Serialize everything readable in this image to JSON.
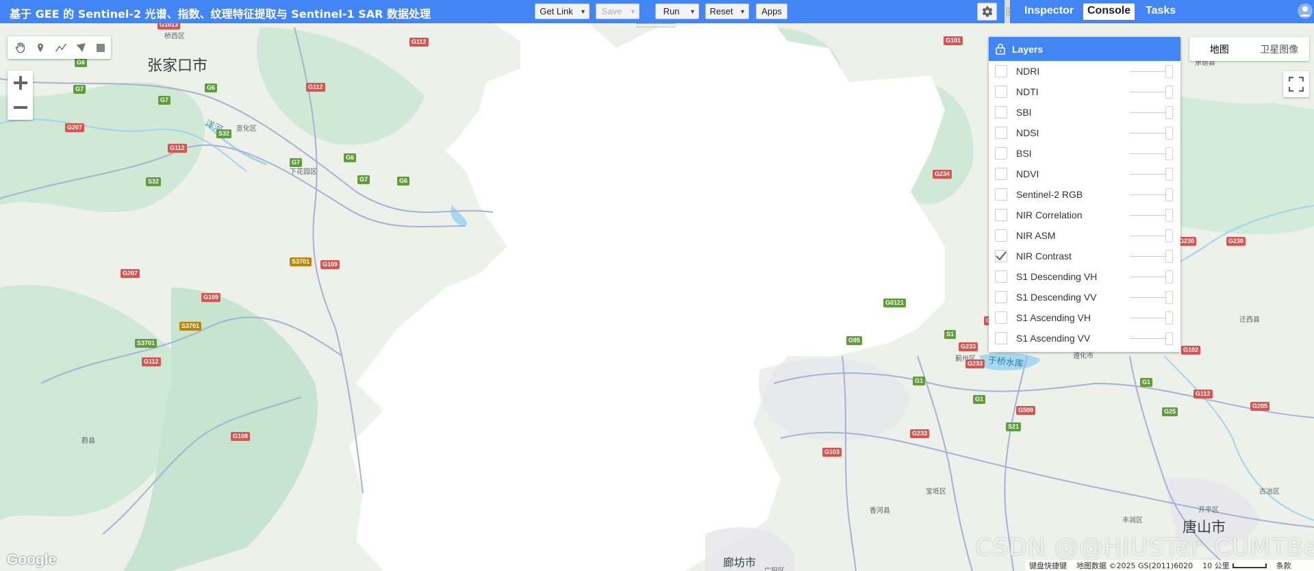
{
  "header": {
    "title": "基于 GEE 的 Sentinel-2 光谱、指数、纹理特征提取与 Sentinel-1 SAR 数据处理",
    "get_link": "Get Link",
    "save": "Save",
    "run": "Run",
    "reset": "Reset",
    "apps": "Apps"
  },
  "panel_tabs": [
    "Inspector",
    "Console",
    "Tasks"
  ],
  "layers": {
    "title": "Layers",
    "items": [
      {
        "name": "NDRI",
        "checked": false
      },
      {
        "name": "NDTI",
        "checked": false
      },
      {
        "name": "SBI",
        "checked": false
      },
      {
        "name": "NDSI",
        "checked": false
      },
      {
        "name": "BSI",
        "checked": false
      },
      {
        "name": "NDVI",
        "checked": false
      },
      {
        "name": "Sentinel-2 RGB",
        "checked": false
      },
      {
        "name": "NIR Correlation",
        "checked": false
      },
      {
        "name": "NIR ASM",
        "checked": false
      },
      {
        "name": "NIR Contrast",
        "checked": true
      },
      {
        "name": "S1 Descending VH",
        "checked": false
      },
      {
        "name": "S1 Descending VV",
        "checked": false
      },
      {
        "name": "S1 Ascending VH",
        "checked": false
      },
      {
        "name": "S1 Ascending VV",
        "checked": false
      }
    ]
  },
  "map_type": {
    "map": "地图",
    "satellite": "卫星图像"
  },
  "map_labels": {
    "zhangjiakou": "张家口市",
    "qiaoxi": "桥西区",
    "xuanhua": "宣化区",
    "xiahuayuan": "下花园区",
    "yanghe": "洋河",
    "yuxian": "蔚县",
    "jizhou": "蓟州区",
    "zunhua": "遵化市",
    "yuqiao": "于桥水库",
    "qianxi": "迁西县",
    "baodi": "宝坻区",
    "xianghe": "香河县",
    "fengrun": "丰润区",
    "kaiping": "开平区",
    "guye": "古冶区",
    "tangshan": "唐山市",
    "langfang": "廊坊市",
    "chengde": "承德县",
    "guangyang": "广阳区"
  },
  "footer": {
    "shortcuts": "键盘快捷键",
    "mapdata": "地图数据 ©2025 GS(2011)6020",
    "scale": "10 公里",
    "terms": "条款"
  },
  "google_logo": "Google",
  "watermark": "CSDN @@HIUSTer_CUMTBer",
  "colors": {
    "accent": "#4285f4"
  }
}
